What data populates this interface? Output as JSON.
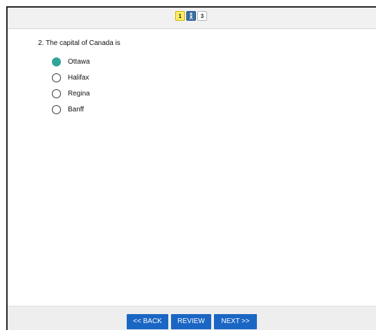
{
  "nav": {
    "questions": [
      {
        "label": "1"
      },
      {
        "label": ""
      },
      {
        "label": "3"
      }
    ]
  },
  "question": {
    "text": "2.  The capital of Canada is",
    "options": [
      {
        "label": "Ottawa",
        "selected": true
      },
      {
        "label": "Halifax",
        "selected": false
      },
      {
        "label": "Regina",
        "selected": false
      },
      {
        "label": "Banff",
        "selected": false
      }
    ]
  },
  "footer": {
    "back_label": "<< BACK",
    "review_label": "REVIEW",
    "next_label": "NEXT >>"
  },
  "colors": {
    "accent": "#2fa59a",
    "button": "#1a66c4",
    "current_question": "#3b6ea5",
    "answered_question": "#ffee66"
  }
}
